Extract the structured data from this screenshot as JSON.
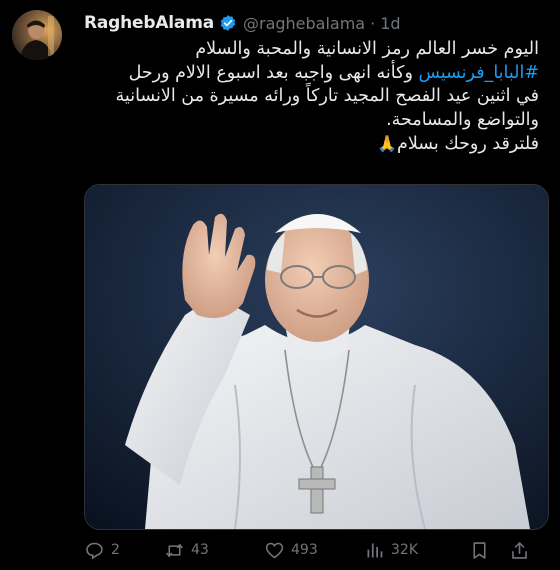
{
  "author": {
    "name": "RaghebAlama",
    "handle": "@raghebalama",
    "separator": "·",
    "time": "1d"
  },
  "tweet": {
    "line1": "اليوم خسر العالم رمز الانسانية والمحبة والسلام",
    "hashtag": "#البابا_فرنسيس",
    "line2_rest": " وكأنه انهى واجبه بعد اسبوع الالام ورحل",
    "line3": "في اثنين عيد الفصح المجيد تاركاً ورائه مسيرة من الانسانية",
    "line4": "والتواضع والمسامحة.",
    "line5": "فلترقد روحك بسلام"
  },
  "actions": {
    "replies": "2",
    "retweets": "43",
    "likes": "493",
    "views": "32K"
  },
  "colors": {
    "background": "#000000",
    "text": "#e7e9ea",
    "secondary": "#71767b",
    "accent": "#1d9bf0",
    "verified": "#1d9bf0"
  },
  "icons": [
    "verified-badge-icon",
    "reply-icon",
    "retweet-icon",
    "like-icon",
    "views-icon",
    "bookmark-icon",
    "share-icon"
  ]
}
